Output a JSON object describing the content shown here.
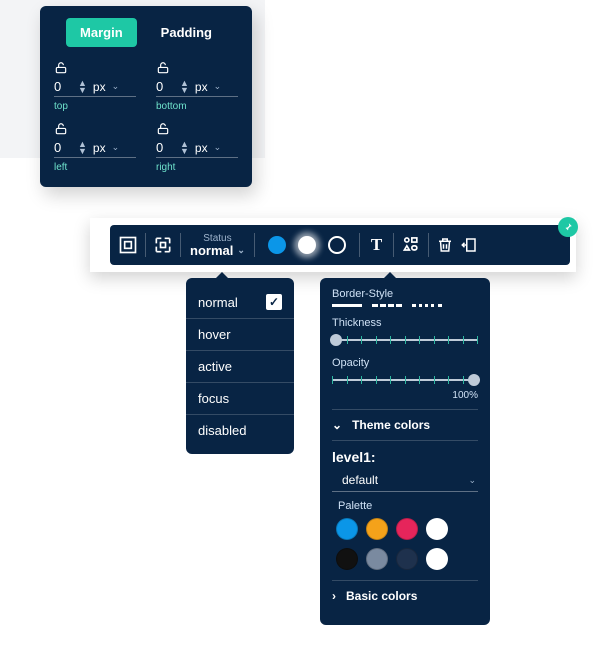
{
  "spacing": {
    "tabs": {
      "margin": "Margin",
      "padding": "Padding",
      "active": "margin"
    },
    "unit": "px",
    "sides": {
      "top": {
        "value": "0",
        "label": "top"
      },
      "bottom": {
        "value": "0",
        "label": "bottom"
      },
      "left": {
        "value": "0",
        "label": "left"
      },
      "right": {
        "value": "0",
        "label": "right"
      }
    }
  },
  "toolbar": {
    "status_label": "Status",
    "status_value": "normal"
  },
  "status_options": [
    {
      "label": "normal",
      "selected": true
    },
    {
      "label": "hover",
      "selected": false
    },
    {
      "label": "active",
      "selected": false
    },
    {
      "label": "focus",
      "selected": false
    },
    {
      "label": "disabled",
      "selected": false
    }
  ],
  "border": {
    "style_label": "Border-Style",
    "thickness_label": "Thickness",
    "opacity_label": "Opacity",
    "opacity_value": "100%"
  },
  "colors": {
    "theme_label": "Theme colors",
    "level_label": "level1:",
    "select_value": "default",
    "palette_label": "Palette",
    "basic_label": "Basic colors",
    "swatches": [
      "#0b96e8",
      "#f4a21a",
      "#e6255b",
      "#ffffff",
      "#111111",
      "#7a8aa0",
      "#1e314d",
      "#ffffff"
    ]
  }
}
